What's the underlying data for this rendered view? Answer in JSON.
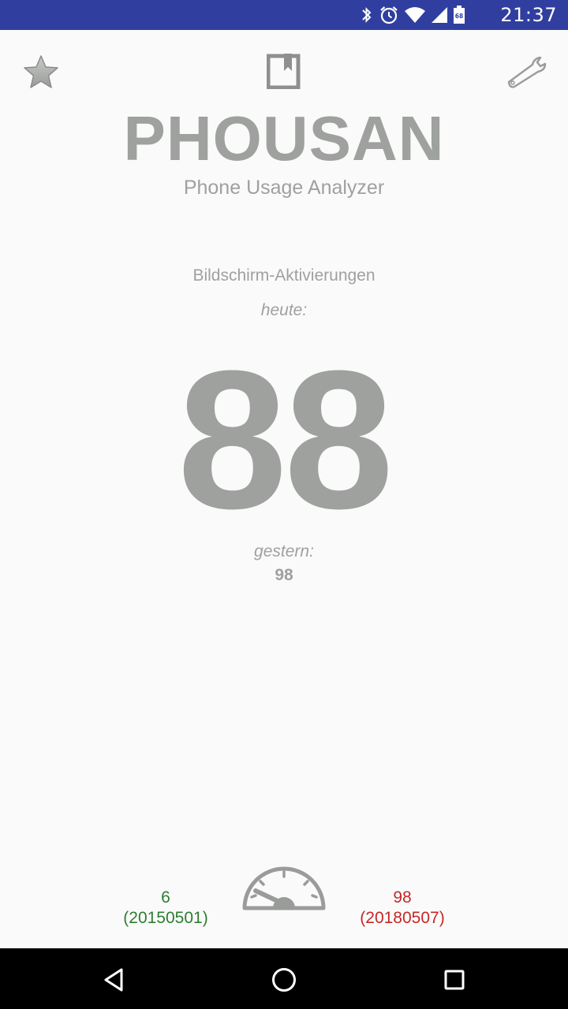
{
  "status_bar": {
    "time": "21:37",
    "battery_level": "68",
    "icons": [
      "bluetooth-icon",
      "alarm-icon",
      "wifi-icon",
      "cell-signal-icon",
      "battery-icon"
    ]
  },
  "toolbar": {
    "favorite_icon": "star-icon",
    "manual_icon": "book-icon",
    "settings_icon": "wrench-icon"
  },
  "app": {
    "title": "PHOUSAN",
    "subtitle": "Phone Usage Analyzer"
  },
  "stats": {
    "metric_label": "Bildschirm-Aktivierungen",
    "today_label": "heute:",
    "today_value": "88",
    "yesterday_label": "gestern:",
    "yesterday_value": "98"
  },
  "records": {
    "min_value": "6",
    "min_date": "(20150501)",
    "max_value": "98",
    "max_date": "(20180507)",
    "gauge_icon": "speedometer-icon"
  },
  "colors": {
    "status_bar": "#303f9f",
    "text_gray": "#9ea19e",
    "min_green": "#2e7d32",
    "max_red": "#c62828"
  },
  "nav_bar": {
    "icons": [
      "back-icon",
      "home-icon",
      "recents-icon"
    ]
  }
}
